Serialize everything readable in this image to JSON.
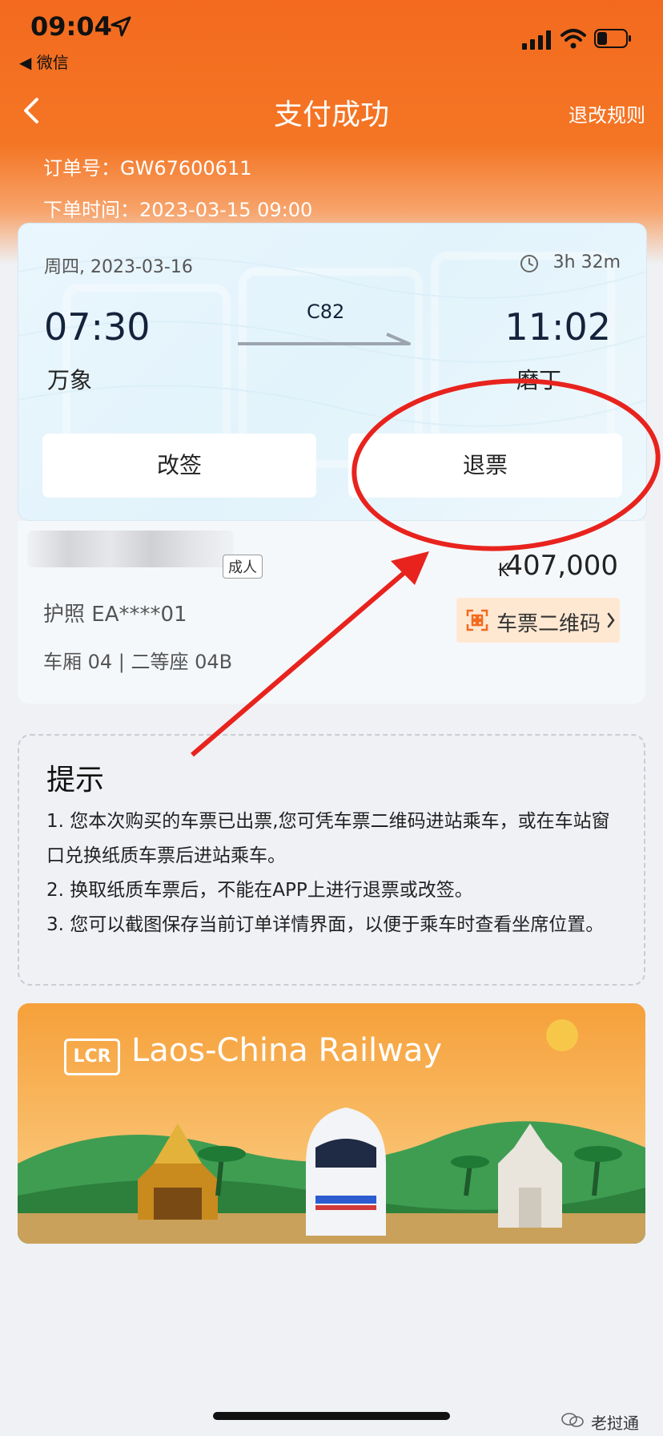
{
  "status_bar": {
    "time": "09:04",
    "back_app": "◀ 微信"
  },
  "nav": {
    "title": "支付成功",
    "rules": "退改规则"
  },
  "order": {
    "number": "订单号：GW67600611",
    "time": "下单时间：2023-03-15 09:00"
  },
  "ticket": {
    "date": "周四, 2023-03-16",
    "duration": "3h 32m",
    "departure_time": "07:30",
    "arrival_time": "11:02",
    "train_no": "C82",
    "departure_station": "万象",
    "arrival_station": "磨丁",
    "change_button": "改签",
    "refund_button": "退票"
  },
  "passenger": {
    "type_badge": "成人",
    "currency": "₭",
    "price": "407,000",
    "id": "护照  EA****01",
    "seat": "车厢 04 | 二等座 04B",
    "qr_button": "车票二维码"
  },
  "notice": {
    "title": "提示",
    "items": [
      "1. 您本次购买的车票已出票,您可凭车票二维码进站乘车，或在车站窗口兑换纸质车票后进站乘车。",
      "2. 换取纸质车票后，不能在APP上进行退票或改签。",
      "3. 您可以截图保存当前订单详情界面，以便于乘车时查看坐席位置。"
    ]
  },
  "banner": {
    "logo": "LCR",
    "text": "Laos-China Railway"
  },
  "watermark": {
    "label": "老挝通"
  },
  "colors": {
    "accent": "#f36a1e",
    "annotation_red": "#e8231e",
    "qr_bg": "#ffe8d2"
  }
}
